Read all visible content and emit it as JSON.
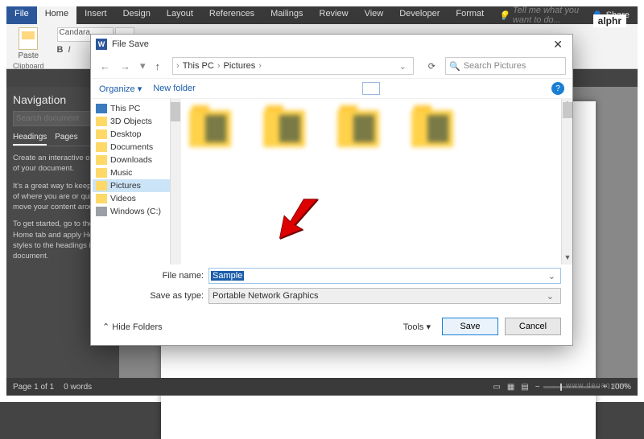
{
  "brand": "alphr",
  "ribbon_tabs": [
    "File",
    "Home",
    "Insert",
    "Design",
    "Layout",
    "References",
    "Mailings",
    "Review",
    "View",
    "Developer",
    "Format"
  ],
  "tellme_placeholder": "Tell me what you want to do...",
  "share_label": "Share",
  "clipboard": {
    "paste": "Paste",
    "group": "Clipboard"
  },
  "font": {
    "name": "Candara",
    "size": ""
  },
  "nav": {
    "title": "Navigation",
    "search_placeholder": "Search document",
    "tabs": [
      "Headings",
      "Pages"
    ],
    "p1": "Create an interactive outline of your document.",
    "p2": "It's a great way to keep track of where you are or quickly move your content around.",
    "p3": "To get started, go to the Home tab and apply Heading styles to the headings in your document."
  },
  "status": {
    "page": "Page 1 of 1",
    "words": "0 words",
    "zoom": "100%"
  },
  "dialog": {
    "title": "File Save",
    "path": [
      "This PC",
      "Pictures"
    ],
    "search_placeholder": "Search Pictures",
    "organize": "Organize",
    "newfolder": "New folder",
    "tree": [
      "This PC",
      "3D Objects",
      "Desktop",
      "Documents",
      "Downloads",
      "Music",
      "Pictures",
      "Videos",
      "Windows (C:)"
    ],
    "filename_label": "File name:",
    "filename_value": "Sample",
    "savetype_label": "Save as type:",
    "savetype_value": "Portable Network Graphics",
    "hide": "Hide Folders",
    "tools": "Tools",
    "save": "Save",
    "cancel": "Cancel"
  },
  "watermark": "www.deuaq.com"
}
